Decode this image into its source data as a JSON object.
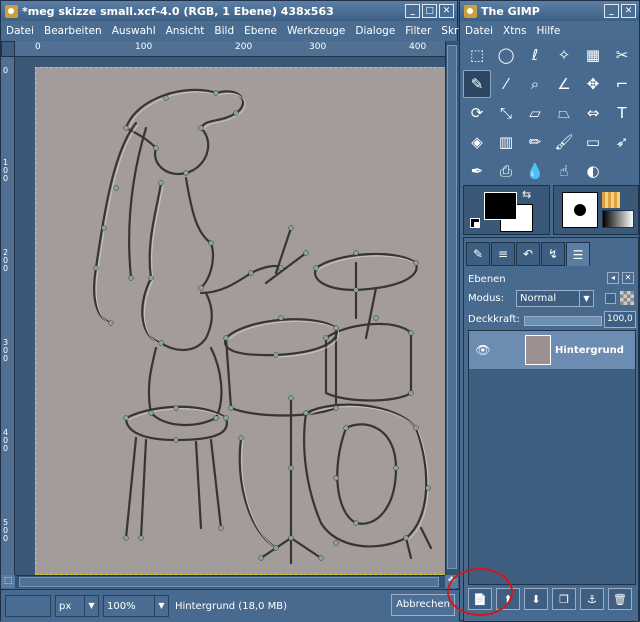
{
  "image_window": {
    "title": "*meg skizze small.xcf-4.0 (RGB, 1 Ebene) 438x563",
    "menu": [
      "Datei",
      "Bearbeiten",
      "Auswahl",
      "Ansicht",
      "Bild",
      "Ebene",
      "Werkzeuge",
      "Dialoge",
      "Filter",
      "Skript-Fu"
    ],
    "ruler_top_labels": [
      "0",
      "100",
      "200",
      "300",
      "400"
    ],
    "ruler_left_labels": [
      "0",
      "100",
      "200",
      "300",
      "400",
      "500"
    ],
    "status": {
      "unit": "px",
      "zoom": "100%",
      "info": "Hintergrund (18,0 MB)",
      "cancel_label": "Abbrechen"
    }
  },
  "toolbox": {
    "title": "The GIMP",
    "menu": [
      "Datei",
      "Xtns",
      "Hilfe"
    ],
    "tools": [
      {
        "name": "rect-select-icon",
        "glyph": "⬚"
      },
      {
        "name": "ellipse-select-icon",
        "glyph": "◯"
      },
      {
        "name": "lasso-icon",
        "glyph": "ℓ"
      },
      {
        "name": "magic-wand-icon",
        "glyph": "✧"
      },
      {
        "name": "color-select-icon",
        "glyph": "▦"
      },
      {
        "name": "scissors-icon",
        "glyph": "✂"
      },
      {
        "name": "paths-icon",
        "glyph": "✎"
      },
      {
        "name": "color-picker-icon",
        "glyph": "⁄"
      },
      {
        "name": "zoom-icon",
        "glyph": "⌕"
      },
      {
        "name": "measure-icon",
        "glyph": "∠"
      },
      {
        "name": "move-icon",
        "glyph": "✥"
      },
      {
        "name": "crop-icon",
        "glyph": "⌐"
      },
      {
        "name": "rotate-icon",
        "glyph": "⟳"
      },
      {
        "name": "scale-icon",
        "glyph": "⤡"
      },
      {
        "name": "shear-icon",
        "glyph": "▱"
      },
      {
        "name": "perspective-icon",
        "glyph": "⏢"
      },
      {
        "name": "flip-icon",
        "glyph": "⇔"
      },
      {
        "name": "text-icon",
        "glyph": "T"
      },
      {
        "name": "bucket-fill-icon",
        "glyph": "◈"
      },
      {
        "name": "blend-icon",
        "glyph": "▥"
      },
      {
        "name": "pencil-icon",
        "glyph": "✏"
      },
      {
        "name": "paintbrush-icon",
        "glyph": "🖌"
      },
      {
        "name": "eraser-icon",
        "glyph": "▭"
      },
      {
        "name": "airbrush-icon",
        "glyph": "➶"
      },
      {
        "name": "ink-icon",
        "glyph": "✒"
      },
      {
        "name": "clone-icon",
        "glyph": "⎙"
      },
      {
        "name": "smudge-blur-icon",
        "glyph": "💧"
      },
      {
        "name": "smudge-icon",
        "glyph": "☝"
      },
      {
        "name": "dodge-burn-icon",
        "glyph": "◐"
      }
    ],
    "colors": {
      "foreground": "#000000",
      "background": "#ffffff"
    },
    "layers_panel": {
      "title": "Ebenen",
      "mode_label": "Modus:",
      "mode_value": "Normal",
      "opacity_label": "Deckkraft:",
      "opacity_value": "100,0",
      "opacity_fraction": 1.0,
      "layers": [
        {
          "name": "Hintergrund",
          "visible": true
        }
      ]
    }
  }
}
